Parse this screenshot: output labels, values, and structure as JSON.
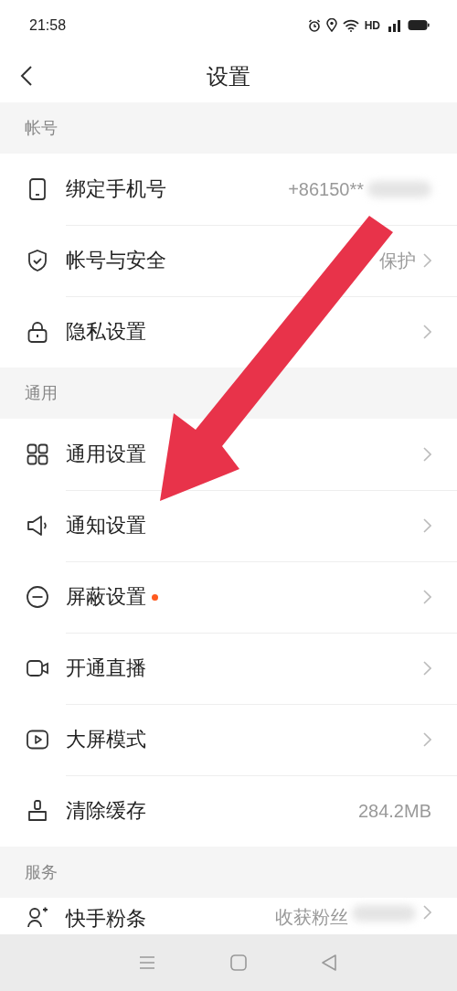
{
  "status_bar": {
    "time": "21:58",
    "network": "HD"
  },
  "header": {
    "title": "设置"
  },
  "sections": [
    {
      "title": "帐号",
      "rows": [
        {
          "label": "绑定手机号",
          "value": "+86150**",
          "blurred": true,
          "chevron": false,
          "dot": false
        },
        {
          "label": "帐号与安全",
          "value": "保护",
          "blurred": false,
          "chevron": true,
          "dot": false
        },
        {
          "label": "隐私设置",
          "blurred": false,
          "chevron": true,
          "dot": false
        }
      ]
    },
    {
      "title": "通用",
      "rows": [
        {
          "label": "通用设置",
          "blurred": false,
          "chevron": true,
          "dot": false
        },
        {
          "label": "通知设置",
          "blurred": false,
          "chevron": true,
          "dot": false
        },
        {
          "label": "屏蔽设置",
          "blurred": false,
          "chevron": true,
          "dot": true
        },
        {
          "label": "开通直播",
          "blurred": false,
          "chevron": true,
          "dot": false
        },
        {
          "label": "大屏模式",
          "blurred": false,
          "chevron": true,
          "dot": false
        },
        {
          "label": "清除缓存",
          "value": "284.2MB",
          "blurred": false,
          "chevron": false,
          "dot": false
        }
      ]
    },
    {
      "title": "服务",
      "rows": [
        {
          "label": "快手粉条",
          "value": "收获粉丝",
          "blurred": true,
          "chevron": true,
          "dot": false
        }
      ]
    }
  ]
}
